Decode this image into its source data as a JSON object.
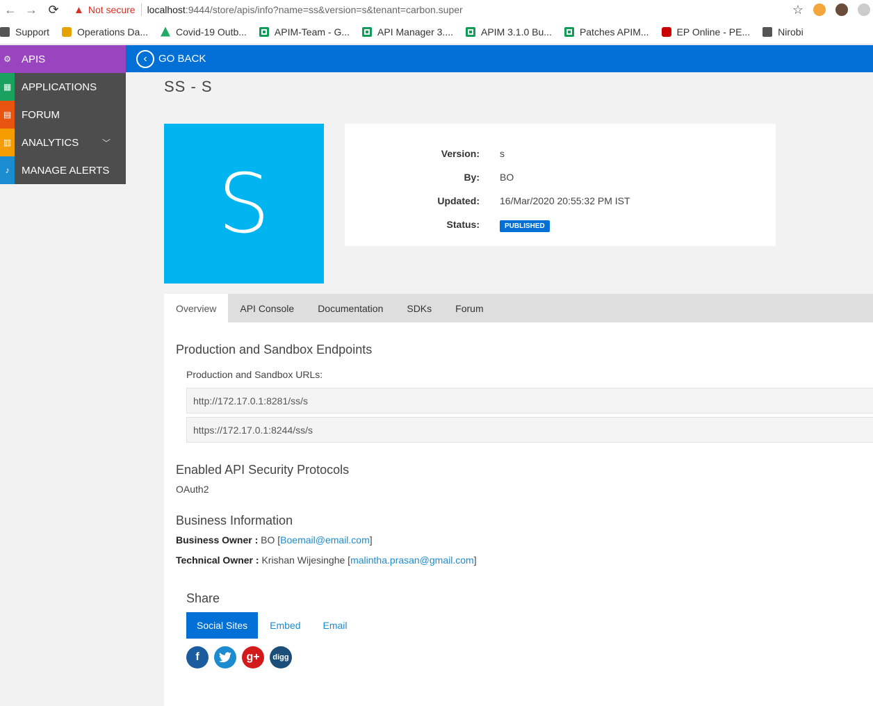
{
  "browser": {
    "not_secure": "Not secure",
    "url_host": "localhost",
    "url_rest": ":9444/store/apis/info?name=ss&version=s&tenant=carbon.super",
    "bookmarks": [
      "Support",
      "Operations Da...",
      "Covid-19 Outb...",
      "APIM-Team - G...",
      "API Manager 3....",
      "APIM 3.1.0 Bu...",
      "Patches APIM...",
      "EP Online - PE...",
      "Nirobi"
    ]
  },
  "topbar": {
    "go_back": "GO BACK"
  },
  "sidebar": {
    "items": [
      {
        "label": "APIS",
        "icon": "api-gear-icon"
      },
      {
        "label": "APPLICATIONS",
        "icon": "applications-icon"
      },
      {
        "label": "FORUM",
        "icon": "forum-icon"
      },
      {
        "label": "ANALYTICS",
        "icon": "analytics-icon"
      },
      {
        "label": "MANAGE ALERTS",
        "icon": "bell-icon"
      }
    ]
  },
  "api": {
    "title": "SS - S",
    "thumb_letter": "S",
    "version_label": "Version:",
    "version": "s",
    "by_label": "By:",
    "by": "BO",
    "updated_label": "Updated:",
    "updated": "16/Mar/2020 20:55:32 PM IST",
    "status_label": "Status:",
    "status": "PUBLISHED"
  },
  "tabs": [
    "Overview",
    "API Console",
    "Documentation",
    "SDKs",
    "Forum"
  ],
  "overview": {
    "endpoints_heading": "Production and Sandbox Endpoints",
    "urls_label": "Production and Sandbox URLs:",
    "urls": [
      "http://172.17.0.1:8281/ss/s",
      "https://172.17.0.1:8244/ss/s"
    ],
    "security_heading": "Enabled API Security Protocols",
    "security": "OAuth2",
    "business_heading": "Business Information",
    "business_owner_label": "Business Owner :",
    "business_owner": "BO",
    "business_owner_email": "Boemail@email.com",
    "technical_owner_label": "Technical Owner :",
    "technical_owner": "Krishan Wijesinghe",
    "technical_owner_email": "malintha.prasan@gmail.com"
  },
  "share": {
    "heading": "Share",
    "tabs": [
      "Social Sites",
      "Embed",
      "Email"
    ],
    "social": [
      "f",
      "g+",
      "digg"
    ]
  },
  "colors": {
    "accent": "#0070d7",
    "thumb": "#00b4f0",
    "apis": "#9a45c0"
  }
}
